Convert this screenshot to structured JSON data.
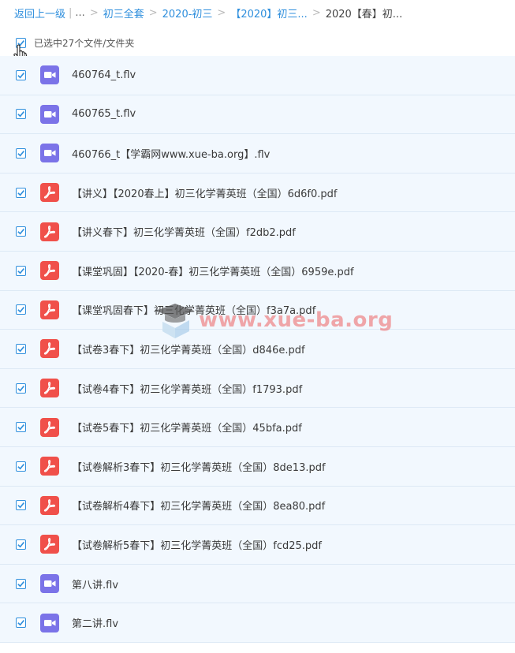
{
  "breadcrumb": {
    "back": "返回上一级",
    "divider": "|",
    "ellipsis": "...",
    "sep": ">",
    "items": [
      "初三全套",
      "2020-初三",
      "【2020】初三...",
      "2020【春】初..."
    ]
  },
  "selection": {
    "label": "已选中27个文件/文件夹",
    "checked": true
  },
  "files": [
    {
      "name": "460764_t.flv",
      "type": "video-icon"
    },
    {
      "name": "460765_t.flv",
      "type": "video-icon"
    },
    {
      "name": "460766_t【学霸网www.xue-ba.org】.flv",
      "type": "video-icon"
    },
    {
      "name": "【讲义】【2020春上】初三化学菁英班（全国）6d6f0.pdf",
      "type": "pdf-icon"
    },
    {
      "name": "【讲义春下】初三化学菁英班（全国）f2db2.pdf",
      "type": "pdf-icon"
    },
    {
      "name": "【课堂巩固】【2020-春】初三化学菁英班（全国）6959e.pdf",
      "type": "pdf-icon"
    },
    {
      "name": "【课堂巩固春下】初三化学菁英班（全国）f3a7a.pdf",
      "type": "pdf-icon"
    },
    {
      "name": "【试卷3春下】初三化学菁英班（全国）d846e.pdf",
      "type": "pdf-icon"
    },
    {
      "name": "【试卷4春下】初三化学菁英班（全国）f1793.pdf",
      "type": "pdf-icon"
    },
    {
      "name": "【试卷5春下】初三化学菁英班（全国）45bfa.pdf",
      "type": "pdf-icon"
    },
    {
      "name": "【试卷解析3春下】初三化学菁英班（全国）8de13.pdf",
      "type": "pdf-icon"
    },
    {
      "name": "【试卷解析4春下】初三化学菁英班（全国）8ea80.pdf",
      "type": "pdf-icon"
    },
    {
      "name": "【试卷解析5春下】初三化学菁英班（全国）fcd25.pdf",
      "type": "pdf-icon"
    },
    {
      "name": "第八讲.flv",
      "type": "video-icon"
    },
    {
      "name": "第二讲.flv",
      "type": "video-icon"
    }
  ],
  "watermark": {
    "text": "www.xue-ba.org"
  },
  "colors": {
    "accent": "#2f8fdd",
    "video": "#7b73e8",
    "pdf": "#f0504a",
    "row_bg": "#f2f8fe"
  }
}
